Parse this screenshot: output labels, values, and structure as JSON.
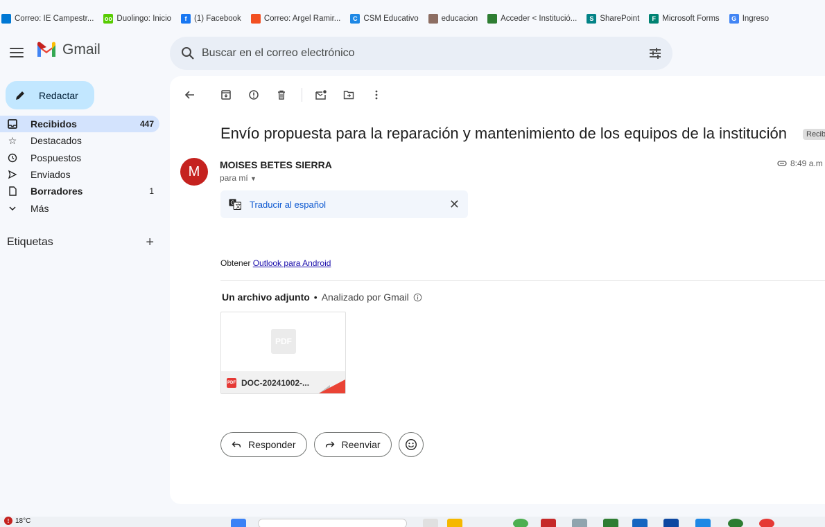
{
  "bookmarks": [
    {
      "label": "Correo: IE Campestr...",
      "color": "#0078d4",
      "glyph": ""
    },
    {
      "label": "Duolingo: Inicio",
      "color": "#58cc02",
      "glyph": "oo"
    },
    {
      "label": "(1) Facebook",
      "color": "#1877f2",
      "glyph": "f"
    },
    {
      "label": "Correo: Argel Ramir...",
      "color": "#f25022",
      "glyph": ""
    },
    {
      "label": "CSM Educativo",
      "color": "#1e88e5",
      "glyph": "C"
    },
    {
      "label": "educacion",
      "color": "#8d6e63",
      "glyph": ""
    },
    {
      "label": "Acceder < Institució...",
      "color": "#2e7d32",
      "glyph": ""
    },
    {
      "label": "SharePoint",
      "color": "#038387",
      "glyph": "S"
    },
    {
      "label": "Microsoft Forms",
      "color": "#008272",
      "glyph": "F"
    },
    {
      "label": "Ingreso",
      "color": "#4285f4",
      "glyph": "G"
    }
  ],
  "app": {
    "name": "Gmail"
  },
  "search": {
    "placeholder": "Buscar en el correo electrónico"
  },
  "compose": {
    "label": "Redactar"
  },
  "nav": [
    {
      "label": "Recibidos",
      "count": "447",
      "icon": "inbox-icon"
    },
    {
      "label": "Destacados",
      "count": "",
      "icon": "star-icon"
    },
    {
      "label": "Pospuestos",
      "count": "",
      "icon": "clock-icon"
    },
    {
      "label": "Enviados",
      "count": "",
      "icon": "send-icon"
    },
    {
      "label": "Borradores",
      "count": "1",
      "icon": "draft-icon"
    },
    {
      "label": "Más",
      "count": "",
      "icon": "chevron-down-icon"
    }
  ],
  "labels_title": "Etiquetas",
  "email": {
    "subject": "Envío propuesta para la reparación y mantenimiento de los equipos de la institución",
    "tag": "Recib",
    "avatar_letter": "M",
    "sender": "MOISES BETES SIERRA",
    "to": "para mí",
    "time": "8:49 a.m",
    "translate": "Traducir al español",
    "body_prefix": "Obtener ",
    "body_link": "Outlook para Android",
    "attach_count": "Un archivo adjunto",
    "attach_sep": "•",
    "attach_scan": "Analizado por Gmail",
    "attachment_name": "DOC-20241002-...",
    "pdf_label": "PDF",
    "reply": "Responder",
    "forward": "Reenviar"
  },
  "taskbar": {
    "temp": "18°C"
  },
  "colors": {
    "accent": "#0b57d0",
    "compose_bg": "#c2e7ff",
    "active_nav": "#d3e3fd",
    "avatar": "#c5221f"
  }
}
